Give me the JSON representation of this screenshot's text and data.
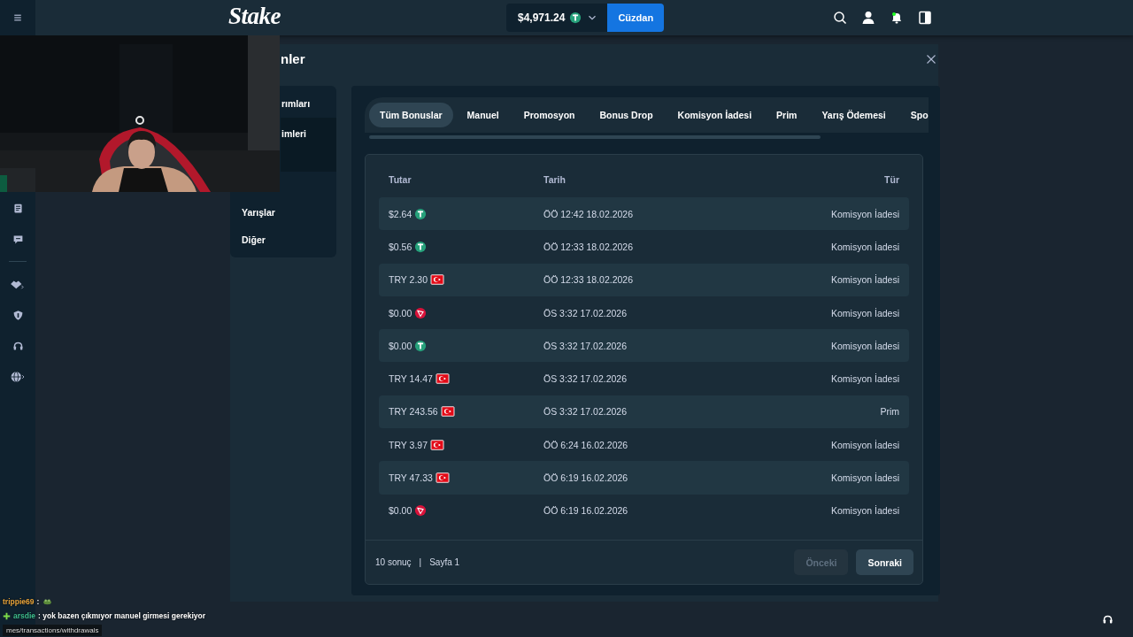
{
  "topbar": {
    "logo": "Stake",
    "balance": "$4,971.24",
    "wallet_button": "Cüzdan"
  },
  "modal": {
    "title": "nler",
    "menu": [
      {
        "label": "rımları",
        "selected": false
      },
      {
        "label": "imleri",
        "selected": true
      },
      {
        "label": "Yarışlar",
        "selected": false
      },
      {
        "label": "Diğer",
        "selected": false
      }
    ],
    "tabs": [
      {
        "label": "Tüm Bonuslar",
        "selected": true
      },
      {
        "label": "Manuel",
        "selected": false
      },
      {
        "label": "Promosyon",
        "selected": false
      },
      {
        "label": "Bonus Drop",
        "selected": false
      },
      {
        "label": "Komisyon İadesi",
        "selected": false
      },
      {
        "label": "Prim",
        "selected": false
      },
      {
        "label": "Yarış Ödemesi",
        "selected": false
      },
      {
        "label": "Spo",
        "selected": false
      }
    ],
    "table": {
      "columns": [
        "Tutar",
        "Tarih",
        "Tür"
      ],
      "rows": [
        {
          "amount": "$2.64",
          "kind": "usdt",
          "date": "ÖÖ 12:42 18.02.2026",
          "type": "Komisyon İadesi"
        },
        {
          "amount": "$0.56",
          "kind": "usdt",
          "date": "ÖÖ 12:33 18.02.2026",
          "type": "Komisyon İadesi"
        },
        {
          "amount": "TRY 2.30",
          "kind": "try",
          "date": "ÖÖ 12:33 18.02.2026",
          "type": "Komisyon İadesi"
        },
        {
          "amount": "$0.00",
          "kind": "trx",
          "date": "ÖS 3:32 17.02.2026",
          "type": "Komisyon İadesi"
        },
        {
          "amount": "$0.00",
          "kind": "usdt",
          "date": "ÖS 3:32 17.02.2026",
          "type": "Komisyon İadesi"
        },
        {
          "amount": "TRY 14.47",
          "kind": "try",
          "date": "ÖS 3:32 17.02.2026",
          "type": "Komisyon İadesi"
        },
        {
          "amount": "TRY 243.56",
          "kind": "try",
          "date": "ÖS 3:32 17.02.2026",
          "type": "Prim"
        },
        {
          "amount": "TRY 3.97",
          "kind": "try",
          "date": "ÖÖ 6:24 16.02.2026",
          "type": "Komisyon İadesi"
        },
        {
          "amount": "TRY 47.33",
          "kind": "try",
          "date": "ÖÖ 6:19 16.02.2026",
          "type": "Komisyon İadesi"
        },
        {
          "amount": "$0.00",
          "kind": "trx",
          "date": "ÖÖ 6:19 16.02.2026",
          "type": "Komisyon İadesi"
        }
      ]
    },
    "footer": {
      "count": "10 sonuç",
      "separator": "|",
      "page": "Sayfa 1",
      "buttons": [
        {
          "label": "Önceki",
          "disabled": true
        },
        {
          "label": "Sonraki",
          "disabled": false
        }
      ]
    }
  },
  "chat": [
    {
      "user": "trippie69",
      "color": "#e8a33a",
      "badge": false,
      "text": ":",
      "emote": true
    },
    {
      "user": "arsdie",
      "color": "#3fbf8f",
      "badge": true,
      "text": ": yok bazen çıkmıyor manuel girmesi gerekiyor",
      "emote": false
    }
  ],
  "status_url": "mes/transactions/withdrawals"
}
